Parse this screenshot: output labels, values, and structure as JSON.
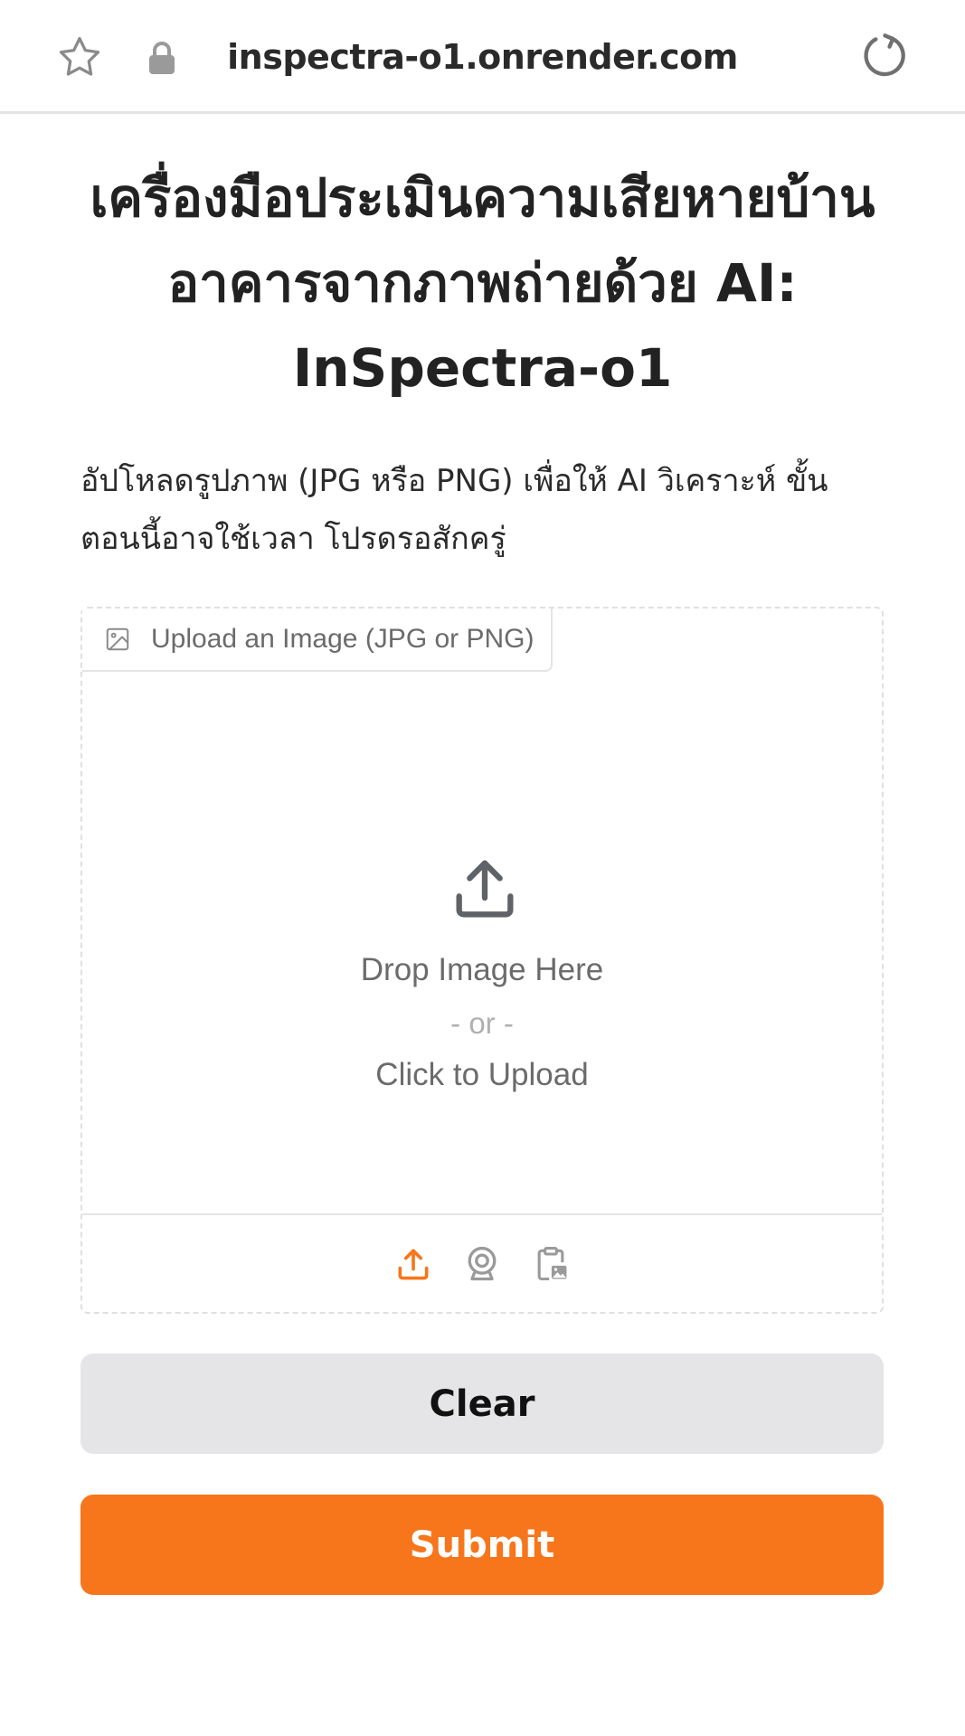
{
  "browser": {
    "url": "inspectra-o1.onrender.com",
    "icons": [
      "star-icon",
      "lock-icon",
      "reload-icon"
    ]
  },
  "page": {
    "title": "เครื่องมือประเมินความเสียหายบ้านอาคารจากภาพถ่ายด้วย AI: InSpectra-o1",
    "description": "อัปโหลดรูปภาพ (JPG หรือ PNG) เพื่อให้ AI วิเคราะห์ ขั้นตอนนี้อาจใช้เวลา โปรดรอสักครู่"
  },
  "upload": {
    "label": "Upload an Image (JPG or PNG)",
    "drop_text": "Drop Image Here",
    "or_text": "- or -",
    "click_text": "Click to Upload",
    "sources": [
      "upload-icon",
      "webcam-icon",
      "clipboard-icon"
    ],
    "active_source": "upload"
  },
  "buttons": {
    "clear_label": "Clear",
    "submit_label": "Submit"
  },
  "colors": {
    "accent": "#f7761b",
    "clear_bg": "#e5e5e8",
    "muted_text": "#6b6b6b"
  }
}
